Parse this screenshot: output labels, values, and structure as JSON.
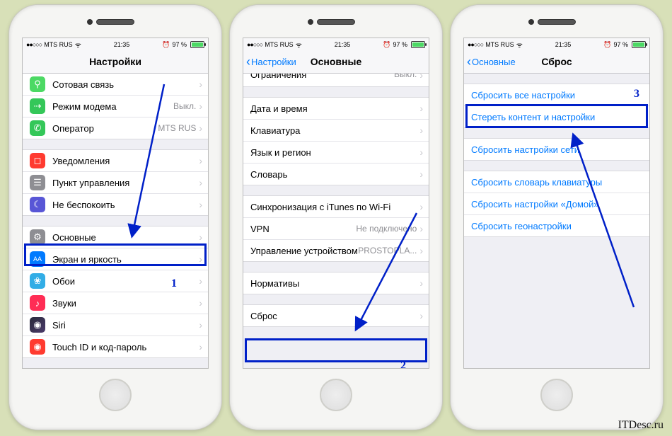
{
  "watermark": "ITDesc.ru",
  "status": {
    "carrier": "MTS RUS",
    "time": "21:35",
    "battery": "97 %"
  },
  "steps": {
    "one": "1",
    "two": "2",
    "three": "3"
  },
  "phone1": {
    "title": "Настройки",
    "rows": {
      "cellular": "Сотовая связь",
      "hotspot": "Режим модема",
      "hotspot_val": "Выкл.",
      "carrier": "Оператор",
      "carrier_val": "MTS RUS",
      "notif": "Уведомления",
      "control": "Пункт управления",
      "dnd": "Не беспокоить",
      "general": "Основные",
      "display": "Экран и яркость",
      "wallpaper": "Обои",
      "sounds": "Звуки",
      "siri": "Siri",
      "touch": "Touch ID и код-пароль"
    }
  },
  "phone2": {
    "back": "Настройки",
    "title": "Основные",
    "rows": {
      "restrict": "Ограничения",
      "restrict_val": "Выкл.",
      "datetime": "Дата и время",
      "keyboard": "Клавиатура",
      "lang": "Язык и регион",
      "dict": "Словарь",
      "itunes": "Синхронизация с iTunes по Wi-Fi",
      "vpn": "VPN",
      "vpn_val": "Не подключено",
      "mgmt": "Управление устройством",
      "mgmt_val": "PROSTOPLA...",
      "legal": "Нормативы",
      "reset": "Сброс"
    }
  },
  "phone3": {
    "back": "Основные",
    "title": "Сброс",
    "rows": {
      "all": "Сбросить все настройки",
      "erase": "Стереть контент и настройки",
      "network": "Сбросить настройки сети",
      "keyboard": "Сбросить словарь клавиатуры",
      "home": "Сбросить настройки «Домой»",
      "location": "Сбросить геонастройки"
    }
  }
}
